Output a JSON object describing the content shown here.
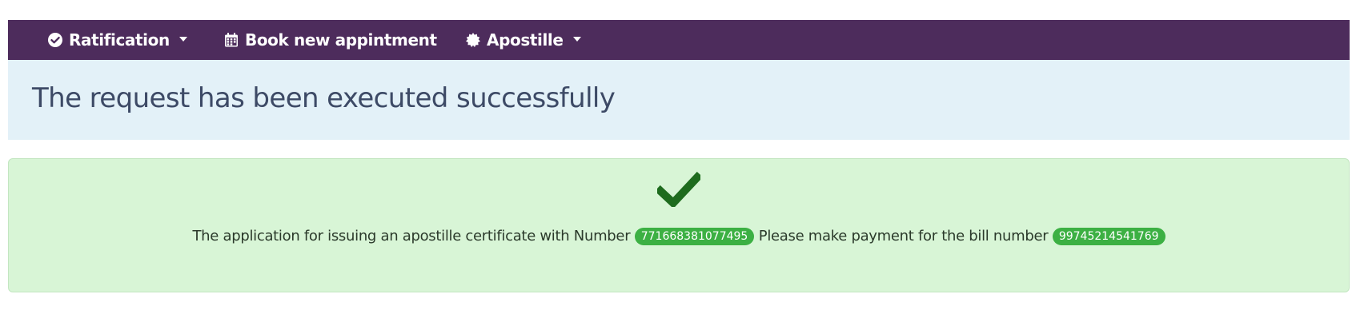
{
  "navbar": {
    "items": [
      {
        "label": "Ratification",
        "icon": "check-circle-icon",
        "has_dropdown": true
      },
      {
        "label": "Book new appintment",
        "icon": "calendar-icon",
        "has_dropdown": false
      },
      {
        "label": "Apostille",
        "icon": "seal-badge-icon",
        "has_dropdown": true
      }
    ],
    "background_color": "#4d2c5c"
  },
  "heading": {
    "text": "The request has been executed successfully"
  },
  "alert": {
    "icon": "checkmark-icon",
    "text_before": "The application for issuing an apostille certificate with Number",
    "application_number": "771668381077495",
    "text_middle": "Please make payment for the bill number",
    "bill_number": "99745214541769",
    "background_color": "#d8f5d6",
    "badge_color": "#3cb043",
    "icon_color": "#1e6b1e"
  }
}
